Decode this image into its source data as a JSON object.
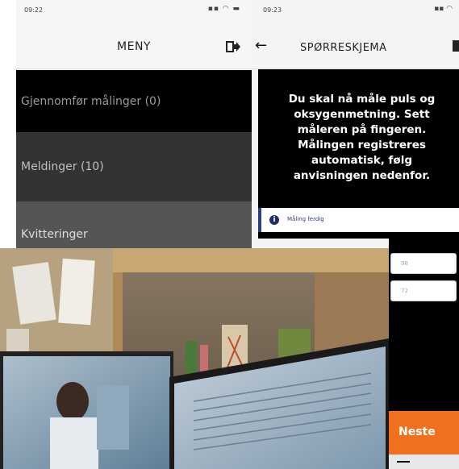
{
  "left_screen": {
    "status_time": "09:22",
    "status_icons": "▪▪ ◠ ▬",
    "nav_title": "MENY",
    "menu_items": [
      {
        "label": "Gjennomfør målinger (0)"
      },
      {
        "label": "Meldinger (10)"
      },
      {
        "label": "Kvitteringer"
      }
    ]
  },
  "right_screen": {
    "status_time": "09:23",
    "status_icons": "▪▪ ◠",
    "nav_title": "SPØRRESKJEMA",
    "instruction": "Du skal nå måle puls og oksygenmetning. Sett måleren på fingeren. Målingen registreres automatisk, følg anvisningen nedenfor.",
    "info_icon": "i",
    "info_text": "Måling ferdig",
    "field_values": [
      "98",
      "72"
    ],
    "next_button": "Neste"
  },
  "colors": {
    "accent_orange": "#f07020",
    "info_blue": "#2b3f78"
  },
  "icons": [
    "status-time-arrow",
    "logout-icon",
    "back-arrow-icon",
    "home-icon",
    "info-icon"
  ]
}
